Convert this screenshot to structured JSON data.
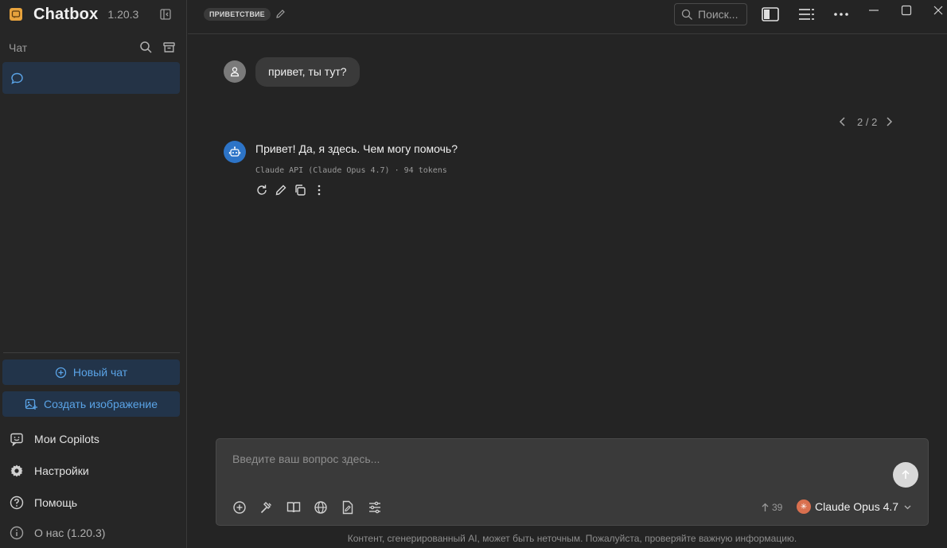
{
  "app": {
    "name": "Chatbox",
    "version": "1.20.3"
  },
  "sidebar": {
    "section_title": "Чат",
    "chat_items": [
      {
        "label": ""
      }
    ],
    "new_chat": "Новый чат",
    "create_image": "Создать изображение",
    "menu": {
      "copilots": "Мои Copilots",
      "settings": "Настройки",
      "help": "Помощь",
      "about": "О нас (1.20.3)"
    }
  },
  "header": {
    "topic": "ПРИВЕТСТВИЕ",
    "search_placeholder": "Поиск..."
  },
  "messages": {
    "user_text": "привет, ты тут?",
    "pager": "2 / 2",
    "bot_text": "Привет! Да, я здесь. Чем могу помочь?",
    "bot_meta": "Claude API (Claude Opus 4.7) · 94 tokens"
  },
  "composer": {
    "placeholder": "Введите ваш вопрос здесь...",
    "context_count": "39",
    "model": "Claude Opus 4.7"
  },
  "footer_note": "Контент, сгенерированный AI, может быть неточным. Пожалуйста, проверяйте важную информацию.",
  "colors": {
    "accent": "#5aa3e6",
    "bot_avatar": "#2d74c7",
    "model_badge": "#d9704f",
    "logo": "#e8a33d"
  }
}
